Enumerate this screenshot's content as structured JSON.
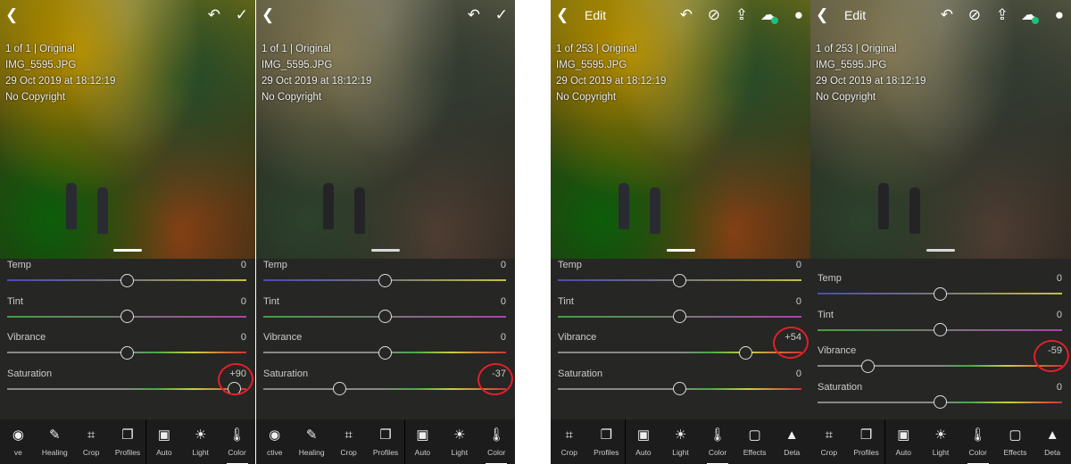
{
  "panels": [
    {
      "header": {
        "edit_label": "",
        "icons": [
          "back-icon",
          "undo-icon",
          "check-icon"
        ]
      },
      "info": {
        "count": "1 of 1 | Original",
        "filename": "IMG_5595.JPG",
        "date": "29 Oct 2019 at 18:12:19",
        "copyright": "No Copyright"
      },
      "sliders": [
        {
          "label": "Temp",
          "value": "0",
          "num": 0
        },
        {
          "label": "Tint",
          "value": "0",
          "num": 0
        },
        {
          "label": "Vibrance",
          "value": "0",
          "num": 0
        },
        {
          "label": "Saturation",
          "value": "+90",
          "num": 90
        }
      ],
      "highlight": "Saturation",
      "look": "vivid",
      "tools": [
        {
          "label": "ve",
          "icon": "selective-icon"
        },
        {
          "label": "Healing",
          "icon": "healing-icon"
        },
        {
          "label": "Crop",
          "icon": "crop-icon"
        },
        {
          "label": "Profiles",
          "icon": "profiles-icon"
        },
        {
          "label": "Auto",
          "icon": "auto-icon"
        },
        {
          "label": "Light",
          "icon": "light-icon"
        },
        {
          "label": "Color",
          "icon": "color-icon",
          "active": true
        }
      ]
    },
    {
      "header": {
        "edit_label": "",
        "icons": [
          "back-icon",
          "undo-icon",
          "check-icon"
        ]
      },
      "info": {
        "count": "1 of 1 | Original",
        "filename": "IMG_5595.JPG",
        "date": "29 Oct 2019 at 18:12:19",
        "copyright": "No Copyright"
      },
      "sliders": [
        {
          "label": "Temp",
          "value": "0",
          "num": 0
        },
        {
          "label": "Tint",
          "value": "0",
          "num": 0
        },
        {
          "label": "Vibrance",
          "value": "0",
          "num": 0
        },
        {
          "label": "Saturation",
          "value": "-37",
          "num": -37
        }
      ],
      "highlight": "Saturation",
      "look": "dim",
      "tools": [
        {
          "label": "ctive",
          "icon": "selective-icon"
        },
        {
          "label": "Healing",
          "icon": "healing-icon"
        },
        {
          "label": "Crop",
          "icon": "crop-icon"
        },
        {
          "label": "Profiles",
          "icon": "profiles-icon"
        },
        {
          "label": "Auto",
          "icon": "auto-icon"
        },
        {
          "label": "Light",
          "icon": "light-icon"
        },
        {
          "label": "Color",
          "icon": "color-icon",
          "active": true
        }
      ]
    },
    {
      "header": {
        "edit_label": "Edit",
        "icons": [
          "back-icon",
          "undo-icon",
          "help-icon",
          "share-icon",
          "cloud-sync-icon",
          "more-icon"
        ]
      },
      "info": {
        "count": "1 of 253 | Original",
        "filename": "IMG_5595.JPG",
        "date": "29 Oct 2019 at 18:12:19",
        "copyright": "No Copyright"
      },
      "sliders": [
        {
          "label": "Temp",
          "value": "0",
          "num": 0
        },
        {
          "label": "Tint",
          "value": "0",
          "num": 0
        },
        {
          "label": "Vibrance",
          "value": "+54",
          "num": 54
        },
        {
          "label": "Saturation",
          "value": "0",
          "num": 0
        }
      ],
      "highlight": "Vibrance",
      "look": "vivid",
      "tools": [
        {
          "label": "Crop",
          "icon": "crop-icon"
        },
        {
          "label": "Profiles",
          "icon": "profiles-icon"
        },
        {
          "label": "Auto",
          "icon": "auto-icon"
        },
        {
          "label": "Light",
          "icon": "light-icon"
        },
        {
          "label": "Color",
          "icon": "color-icon",
          "active": true
        },
        {
          "label": "Effects",
          "icon": "effects-icon"
        },
        {
          "label": "Deta",
          "icon": "detail-icon"
        }
      ]
    },
    {
      "header": {
        "edit_label": "Edit",
        "icons": [
          "back-icon",
          "undo-icon",
          "help-icon",
          "share-icon",
          "cloud-sync-icon",
          "more-icon"
        ]
      },
      "info": {
        "count": "1 of 253 | Original",
        "filename": "IMG_5595.JPG",
        "date": "29 Oct 2019 at 18:12:19",
        "copyright": "No Copyright"
      },
      "sliders": [
        {
          "label": "Temp",
          "value": "0",
          "num": 0
        },
        {
          "label": "Tint",
          "value": "0",
          "num": 0
        },
        {
          "label": "Vibrance",
          "value": "-59",
          "num": -59
        },
        {
          "label": "Saturation",
          "value": "0",
          "num": 0
        }
      ],
      "highlight": "Vibrance",
      "look": "dim",
      "tools": [
        {
          "label": "Crop",
          "icon": "crop-icon"
        },
        {
          "label": "Profiles",
          "icon": "profiles-icon"
        },
        {
          "label": "Auto",
          "icon": "auto-icon"
        },
        {
          "label": "Light",
          "icon": "light-icon"
        },
        {
          "label": "Color",
          "icon": "color-icon",
          "active": true
        },
        {
          "label": "Effects",
          "icon": "effects-icon"
        },
        {
          "label": "Deta",
          "icon": "detail-icon"
        }
      ]
    }
  ],
  "colors": {
    "annotation": "#e0202a",
    "active_underline": "#ffffff",
    "sync_dot": "#1fbf7a"
  }
}
